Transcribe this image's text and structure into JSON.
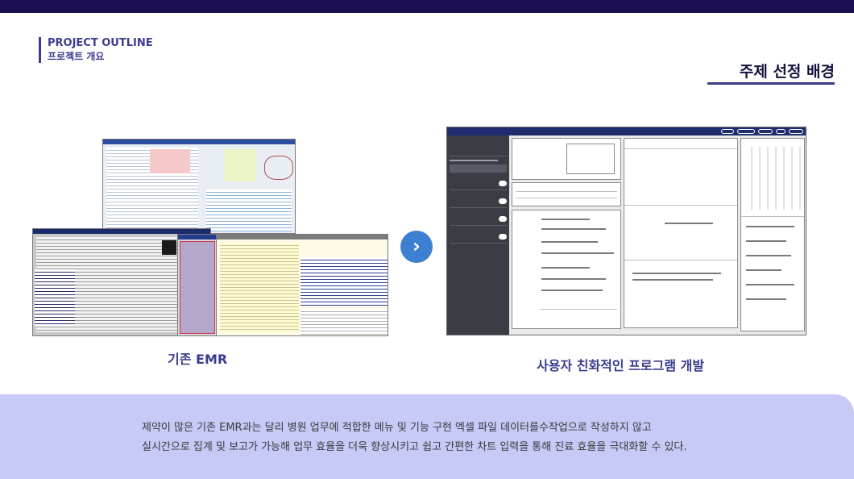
{
  "header": {
    "outline_en": "PROJECT OUTLINE",
    "outline_ko": "프로젝트 개요",
    "section_title": "주제 선정 배경"
  },
  "colors": {
    "navy": "#1b0f52",
    "accent": "#3b3c8e",
    "arrow": "#3d7fd1",
    "panel": "#c7c9f7"
  },
  "legacy": {
    "caption": "기존 EMR"
  },
  "arrow": {
    "icon": "chevron-right-icon",
    "glyph": "›"
  },
  "new_program": {
    "caption": "사용자 친화적인 프로그램 개발"
  },
  "description": {
    "line1": "제약이 많은 기존 EMR과는  달리 병원 업무에 적합한 메뉴  및 기능 구현 엑셀 파일 데이터를수작업으로 작성하지 않고",
    "line2": "실시간으로 집계 및  보고가 가능해 업무 효율을 더욱 향상시키고 쉽고 간편한 차트 입력을 통해 진료 효율을 극대화할 수 있다."
  }
}
